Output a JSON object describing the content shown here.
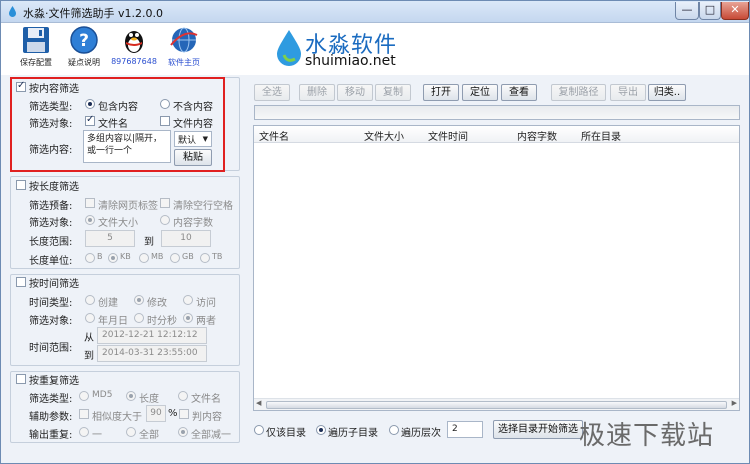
{
  "window": {
    "title": "水淼·文件筛选助手 v1.2.0.0",
    "controls": {
      "minimize": "—",
      "maximize": "□",
      "close": "✕"
    }
  },
  "toolbar": {
    "save_config": "保存配置",
    "faq": "疑点说明",
    "qq": "897687648",
    "homepage": "软件主页"
  },
  "logo": {
    "cn": "水淼软件",
    "en": "shuimiao.net"
  },
  "content_filter": {
    "title": "按内容筛选",
    "type_label": "筛选类型:",
    "type_options": [
      "包含内容",
      "不含内容"
    ],
    "target_label": "筛选对象:",
    "target_options": [
      "文件名",
      "文件内容"
    ],
    "content_label": "筛选内容:",
    "content_text": "多组内容以|隔开，或一行一个",
    "encoding_select": "默认",
    "paste_button": "粘贴"
  },
  "length_filter": {
    "title": "按长度筛选",
    "preset_label": "筛选预备:",
    "preset_options": [
      "清除网页标签",
      "清除空行空格"
    ],
    "target_label": "筛选对象:",
    "target_options": [
      "文件大小",
      "内容字数"
    ],
    "range_label": "长度范围:",
    "range_from": "5",
    "range_to_label": "到",
    "range_to": "10",
    "unit_label": "长度单位:",
    "unit_options": [
      "B",
      "KB",
      "MB",
      "GB",
      "TB"
    ]
  },
  "time_filter": {
    "title": "按时间筛选",
    "type_label": "时间类型:",
    "type_options": [
      "创建",
      "修改",
      "访问"
    ],
    "target_label": "筛选对象:",
    "target_options": [
      "年月日",
      "时分秒",
      "两者"
    ],
    "range_label": "时间范围:",
    "from_label": "从",
    "from_value": "2012-12-21 12:12:12",
    "to_label": "到",
    "to_value": "2014-03-31 23:55:00"
  },
  "duplicate_filter": {
    "title": "按重复筛选",
    "type_label": "筛选类型:",
    "type_options": [
      "MD5",
      "长度",
      "文件名"
    ],
    "aux_label": "辅助参数:",
    "similarity_label": "相似度大于",
    "similarity_value": "90",
    "percent": "%",
    "content_judge": "判内容",
    "output_label": "输出重复:",
    "output_options": [
      "一",
      "全部",
      "全部减一"
    ]
  },
  "actions": {
    "select_all": "全选",
    "delete": "删除",
    "move": "移动",
    "copy": "复制",
    "open": "打开",
    "locate": "定位",
    "view": "查看",
    "copy_path": "复制路径",
    "export": "导出",
    "classify": "归类.."
  },
  "table": {
    "columns": [
      "文件名",
      "文件大小",
      "文件时间",
      "内容字数",
      "所在目录"
    ],
    "rows": []
  },
  "bottom": {
    "scan_options": [
      "仅该目录",
      "遍历子目录",
      "遍历层次"
    ],
    "depth_value": "2",
    "start_button": "选择目录开始筛选"
  },
  "watermark": "极速下载站"
}
